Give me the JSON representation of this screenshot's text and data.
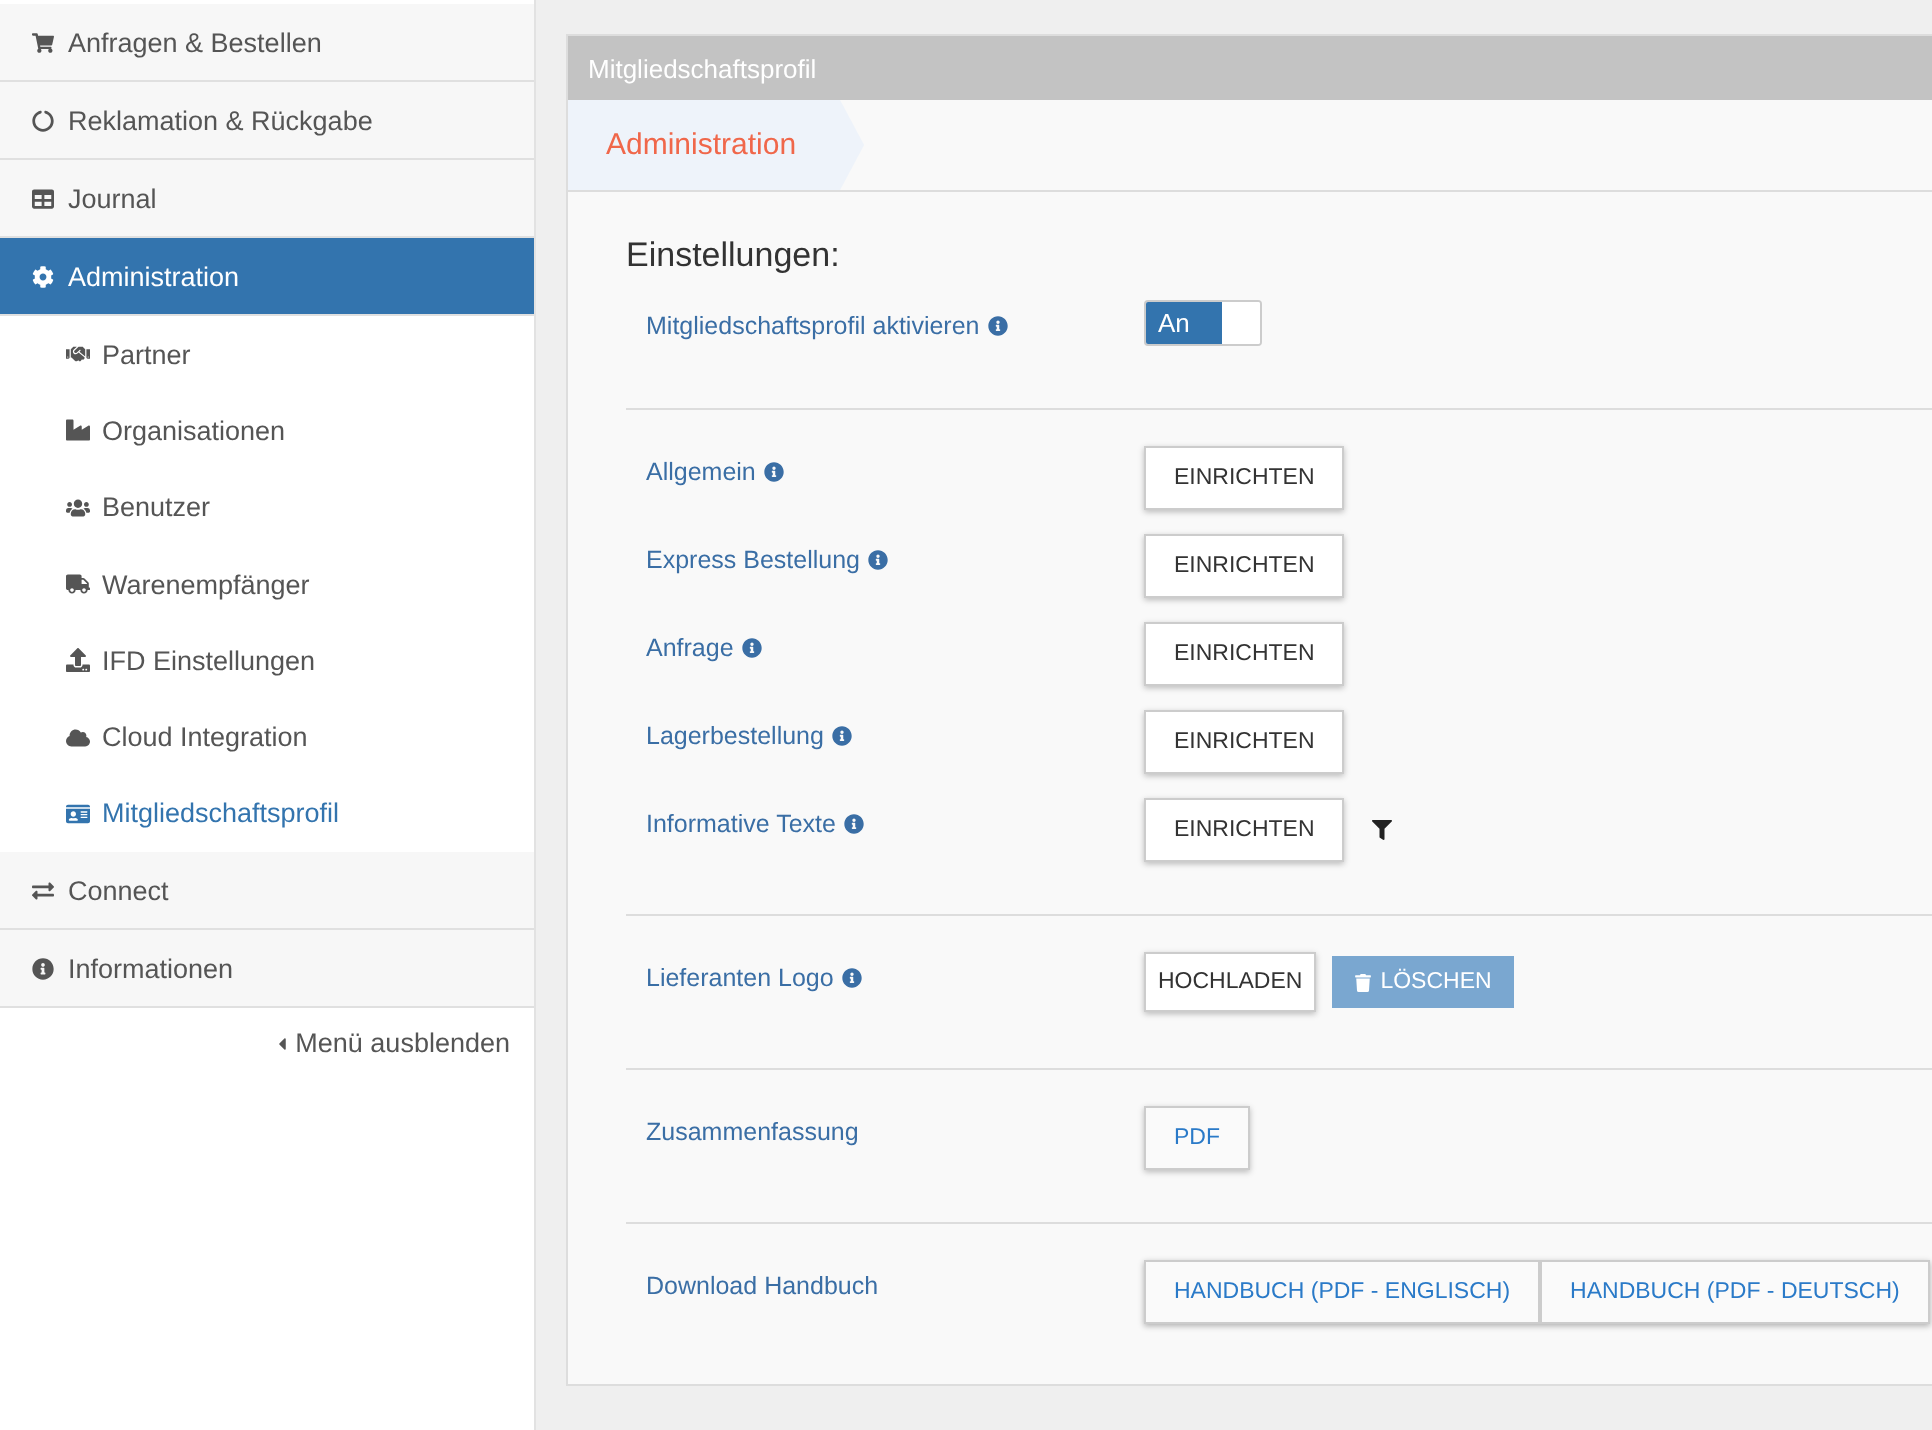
{
  "sidebar": {
    "items": [
      {
        "label": "Anfragen & Bestellen",
        "selected": false
      },
      {
        "label": "Reklamation & Rückgabe",
        "selected": false
      },
      {
        "label": "Journal",
        "selected": false
      },
      {
        "label": "Administration",
        "selected": true,
        "children": [
          {
            "label": "Partner",
            "selected": false
          },
          {
            "label": "Organisationen",
            "selected": false
          },
          {
            "label": "Benutzer",
            "selected": false
          },
          {
            "label": "Warenempfänger",
            "selected": false
          },
          {
            "label": "IFD Einstellungen",
            "selected": false
          },
          {
            "label": "Cloud Integration",
            "selected": false
          },
          {
            "label": "Mitgliedschaftsprofil",
            "selected": true
          }
        ]
      },
      {
        "label": "Connect",
        "selected": false
      },
      {
        "label": "Informationen",
        "selected": false
      }
    ],
    "collapse_link": "Menü ausblenden"
  },
  "panel": {
    "title": "Mitgliedschaftsprofil",
    "breadcrumb": "Administration",
    "heading": "Einstellungen:",
    "sections": [
      {
        "rows": [
          {
            "kind": "toggle",
            "label": "Mitgliedschaftsprofil aktivieren",
            "info": true,
            "on": true,
            "on_label": "An"
          }
        ]
      },
      {
        "rows": [
          {
            "kind": "buttons",
            "label": "Allgemein",
            "info": true,
            "filter": false,
            "buttons": [
              {
                "label": "EINRICHTEN",
                "kind": "default"
              }
            ]
          },
          {
            "kind": "buttons",
            "label": "Express Bestellung",
            "info": true,
            "filter": false,
            "buttons": [
              {
                "label": "EINRICHTEN",
                "kind": "default"
              }
            ]
          },
          {
            "kind": "buttons",
            "label": "Anfrage",
            "info": true,
            "filter": false,
            "buttons": [
              {
                "label": "EINRICHTEN",
                "kind": "default"
              }
            ]
          },
          {
            "kind": "buttons",
            "label": "Lagerbestellung",
            "info": true,
            "filter": false,
            "buttons": [
              {
                "label": "EINRICHTEN",
                "kind": "default"
              }
            ]
          },
          {
            "kind": "buttons",
            "label": "Informative Texte",
            "info": true,
            "filter": true,
            "buttons": [
              {
                "label": "EINRICHTEN",
                "kind": "default"
              }
            ]
          }
        ]
      },
      {
        "rows": [
          {
            "kind": "buttons",
            "label": "Lieferanten Logo",
            "info": true,
            "filter": false,
            "buttons": [
              {
                "label": "HOCHLADEN",
                "kind": "default"
              },
              {
                "label": "LÖSCHEN",
                "kind": "delete"
              }
            ]
          }
        ]
      },
      {
        "rows": [
          {
            "kind": "buttons",
            "label": "Zusammenfassung",
            "info": false,
            "filter": false,
            "buttons": [
              {
                "label": "PDF",
                "kind": "link"
              }
            ]
          }
        ]
      },
      {
        "rows": [
          {
            "kind": "buttons",
            "label": "Download Handbuch",
            "info": false,
            "filter": false,
            "buttons": [
              {
                "label": "HANDBUCH (PDF - ENGLISCH)",
                "kind": "link"
              },
              {
                "label": "HANDBUCH (PDF - DEUTSCH)",
                "kind": "link"
              }
            ]
          }
        ]
      }
    ]
  }
}
